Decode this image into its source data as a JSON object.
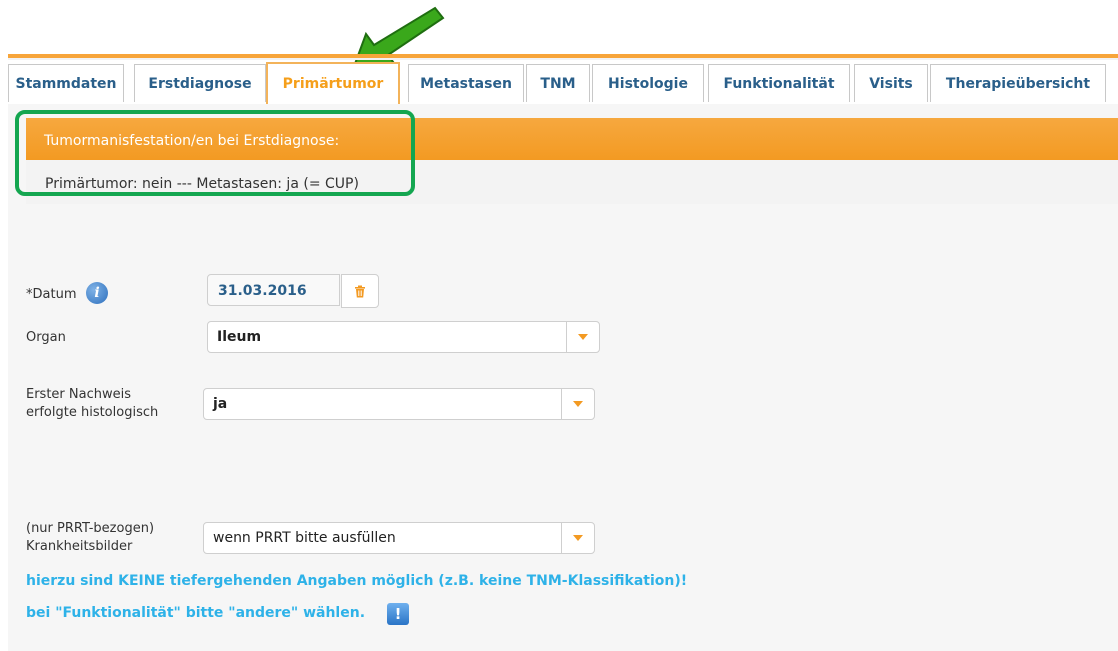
{
  "tabs": [
    {
      "label": "Stammdaten",
      "active": false
    },
    {
      "label": "Erstdiagnose",
      "active": false
    },
    {
      "label": "Primärtumor",
      "active": true
    },
    {
      "label": "Metastasen",
      "active": false
    },
    {
      "label": "TNM",
      "active": false
    },
    {
      "label": "Histologie",
      "active": false
    },
    {
      "label": "Funktionalität",
      "active": false
    },
    {
      "label": "Visits",
      "active": false
    },
    {
      "label": "Therapieübersicht",
      "active": false
    }
  ],
  "section": {
    "title": "Tumormanisfestation/en bei Erstdiagnose:",
    "summary": "Primärtumor: nein --- Metastasen: ja (= CUP)"
  },
  "form": {
    "datum_label": "*Datum",
    "datum_value": "31.03.2016",
    "organ_label": "Organ",
    "organ_value": "Ileum",
    "nachweis_label_line1": "Erster Nachweis",
    "nachweis_label_line2": "erfolgte histologisch",
    "nachweis_value": "ja",
    "prrt_label_line1": "(nur PRRT-bezogen)",
    "prrt_label_line2": "Krankheitsbilder",
    "prrt_value": "wenn PRRT bitte ausfüllen"
  },
  "notes": {
    "line1": "hierzu sind KEINE tiefergehenden Angaben möglich (z.B. keine TNM-Klassifikation)!",
    "line2": "bei \"Funktionalität\" bitte \"andere\" wählen."
  },
  "icons": {
    "info": "info-icon",
    "trash": "trash-icon",
    "warning": "exclamation-icon",
    "annotation_arrow": "green-arrow-icon"
  },
  "colors": {
    "accent": "#f39a22",
    "tab_text": "#2a5f8a",
    "note_text": "#2eb2e8",
    "highlight": "#14a650"
  }
}
